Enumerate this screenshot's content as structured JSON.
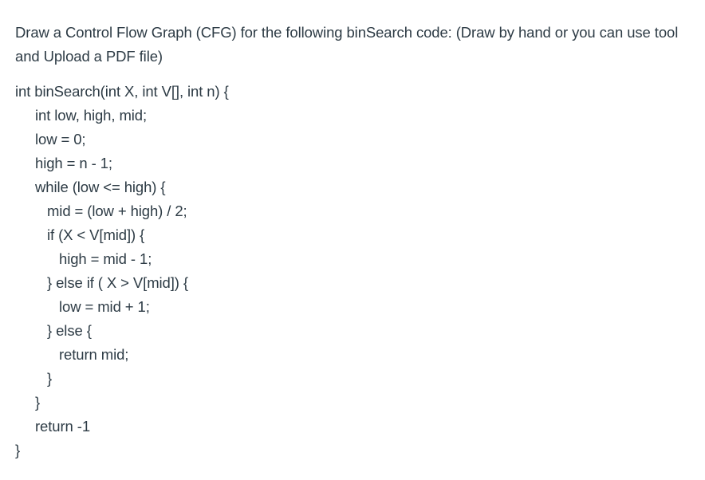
{
  "question": {
    "prompt": "Draw a Control Flow Graph (CFG) for the following binSearch code: (Draw by hand or you can use tool and Upload a PDF file)"
  },
  "code": {
    "lines": [
      {
        "indent": 0,
        "text": "int binSearch(int X, int V[], int n) {"
      },
      {
        "indent": 1,
        "text": "int low, high, mid;"
      },
      {
        "indent": 1,
        "text": "low = 0;"
      },
      {
        "indent": 1,
        "text": "high = n - 1;"
      },
      {
        "indent": 1,
        "text": "while (low <= high) {"
      },
      {
        "indent": 2,
        "text": "mid = (low + high) / 2;"
      },
      {
        "indent": 2,
        "text": "if (X < V[mid]) {"
      },
      {
        "indent": 3,
        "text": "high = mid - 1;"
      },
      {
        "indent": 2,
        "text": "} else if ( X > V[mid]) {"
      },
      {
        "indent": 3,
        "text": "low = mid + 1;"
      },
      {
        "indent": 2,
        "text": "} else {"
      },
      {
        "indent": 3,
        "text": "return mid;"
      },
      {
        "indent": 2,
        "text": "}"
      },
      {
        "indent": 1,
        "text": "}"
      },
      {
        "indent": 1,
        "text": "return -1"
      },
      {
        "indent": 0,
        "text": "}"
      }
    ]
  }
}
